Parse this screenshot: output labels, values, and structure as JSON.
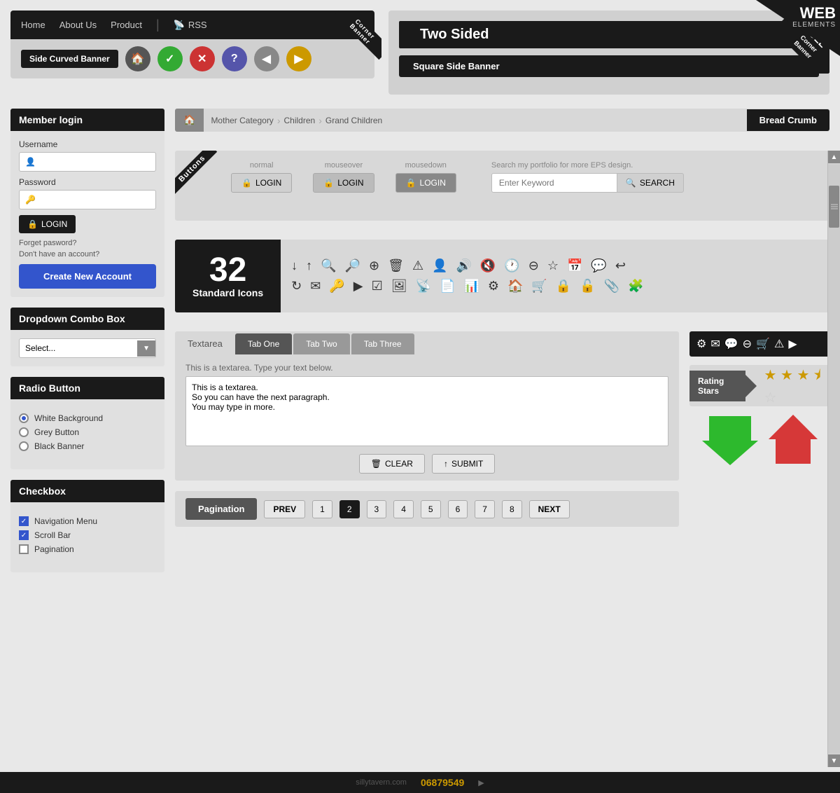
{
  "corner": {
    "web": "WEB",
    "elements": "ELEMENTS"
  },
  "section1": {
    "nav_items": [
      "Home",
      "About Us",
      "Product",
      "RSS"
    ],
    "side_curved_banner": "Side Curved Banner",
    "corner_banner_text": "Corner Banner",
    "two_sided_title": "Two Sided",
    "square_side_banner": "Square Side Banner",
    "full_corner_banner": "FULL Corner Banner"
  },
  "member_login": {
    "title": "Member login",
    "username_label": "Username",
    "username_placeholder": "",
    "password_label": "Password",
    "login_button": "LOGIN",
    "forget_text": "Forget pasword?",
    "no_account_text": "Don't have an account?",
    "create_account_button": "Create New Account"
  },
  "dropdown": {
    "title": "Dropdown Combo Box",
    "placeholder": "Select..."
  },
  "radio": {
    "title": "Radio Button",
    "options": [
      "White Background",
      "Grey Button",
      "Black Banner"
    ],
    "selected": 0
  },
  "checkbox": {
    "title": "Checkbox",
    "items": [
      {
        "label": "Navigation Menu",
        "checked": true
      },
      {
        "label": "Scroll Bar",
        "checked": true
      },
      {
        "label": "Pagination",
        "checked": false
      }
    ]
  },
  "breadcrumb": {
    "items": [
      "Mother Category",
      "Children",
      "Grand Children"
    ],
    "label": "Bread Crumb"
  },
  "buttons_section": {
    "ribbon_text": "Buttons",
    "states": [
      "normal",
      "mouseover",
      "mousedown"
    ],
    "button_label": "LOGIN",
    "search_hint": "Search my portfolio for more EPS design.",
    "search_placeholder": "Enter Keyword",
    "search_button": "SEARCH"
  },
  "icons_section": {
    "count": "32",
    "label": "Standard Icons"
  },
  "tabs_section": {
    "plain_tab": "Textarea",
    "tabs": [
      "Tab One",
      "Tab Two",
      "Tab Three"
    ],
    "active_tab": 0,
    "textarea_hint": "This is a textarea. Type your text below.",
    "textarea_content": "This is a textarea.\nSo you can have the next paragraph.\nYou may type in more.",
    "clear_button": "CLEAR",
    "submit_button": "SUBMIT"
  },
  "pagination": {
    "label": "Pagination",
    "prev": "PREV",
    "next": "NEXT",
    "pages": [
      1,
      2,
      3,
      4,
      5,
      6,
      7,
      8
    ],
    "active_page": 2
  },
  "rating": {
    "label": "Rating Stars",
    "filled": 3,
    "half": true,
    "empty": 1
  },
  "toolbar_icons": [
    "⚙",
    "✉",
    "💬",
    "⊖",
    "🛒",
    "⚠",
    "▶"
  ],
  "scrollbar": {
    "up_arrow": "▲",
    "down_arrow": "▼"
  }
}
